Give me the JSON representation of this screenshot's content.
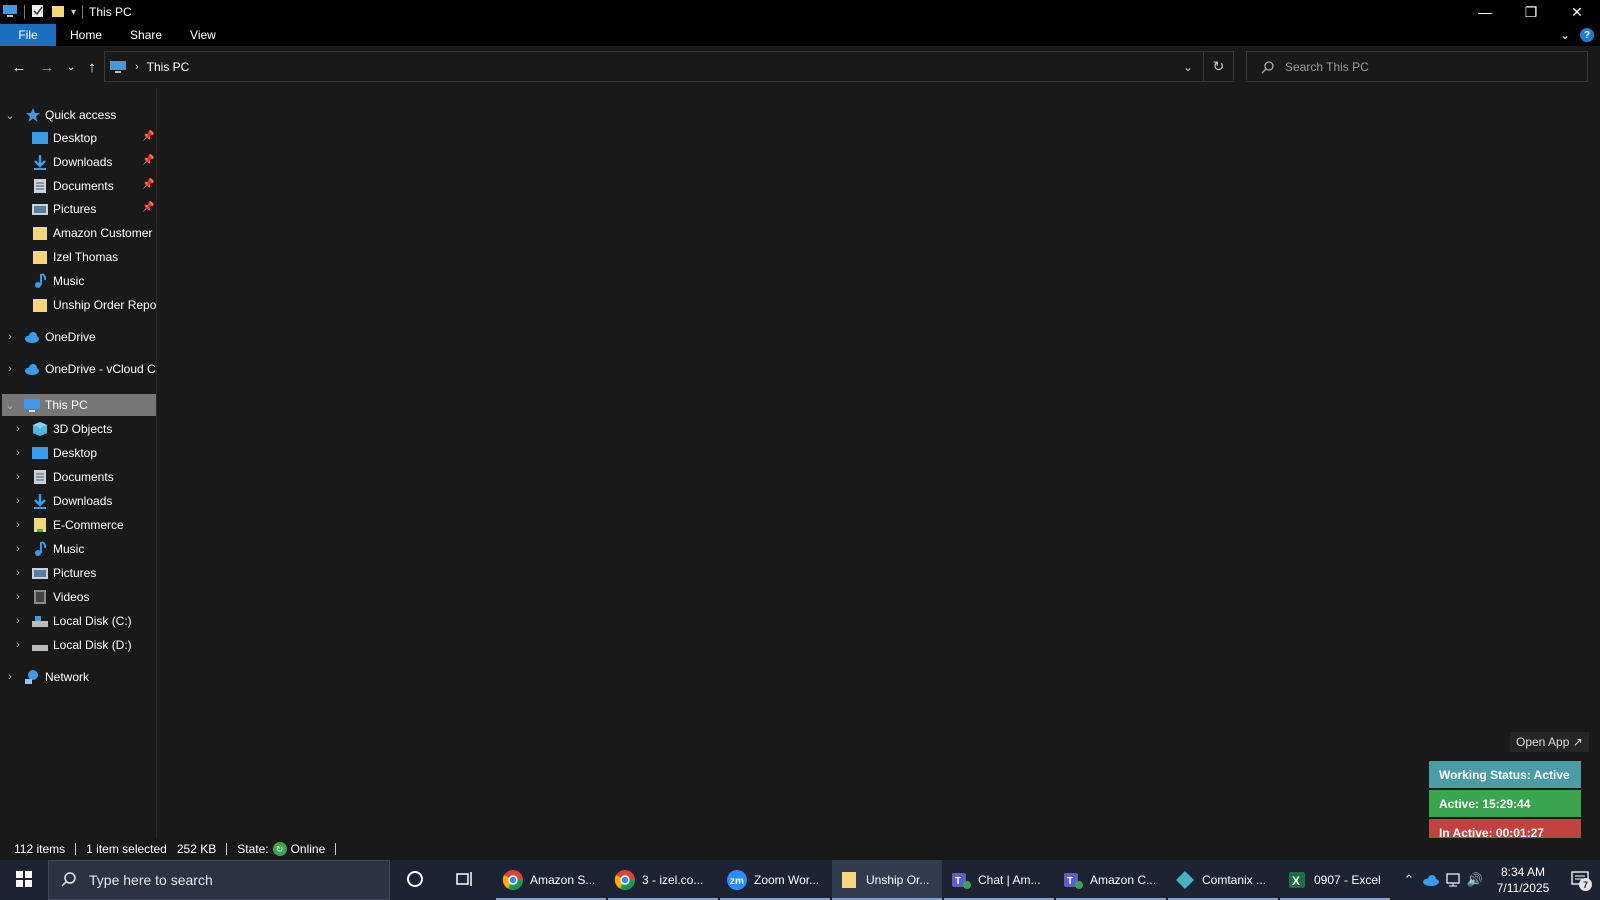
{
  "window": {
    "title": "This PC",
    "controls": [
      "minimize-icon",
      "restore-icon",
      "close-icon"
    ]
  },
  "ribbon": {
    "tabs": [
      {
        "label": "File"
      },
      {
        "label": "Home"
      },
      {
        "label": "Share"
      },
      {
        "label": "View"
      }
    ],
    "help": "?"
  },
  "address": {
    "breadcrumb": "This PC",
    "search_placeholder": "Search This PC"
  },
  "sidebar": {
    "quick_access": {
      "label": "Quick access",
      "items": [
        {
          "label": "Desktop",
          "icon": "desktop-icon",
          "pinned": true
        },
        {
          "label": "Downloads",
          "icon": "downloads-icon",
          "pinned": true
        },
        {
          "label": "Documents",
          "icon": "documents-icon",
          "pinned": true
        },
        {
          "label": "Pictures",
          "icon": "pictures-icon",
          "pinned": true
        },
        {
          "label": "Amazon Customer",
          "icon": "folder-icon",
          "pinned": false
        },
        {
          "label": "Izel Thomas",
          "icon": "folder-icon",
          "pinned": false
        },
        {
          "label": "Music",
          "icon": "music-icon",
          "pinned": false
        },
        {
          "label": "Unship Order Repor",
          "icon": "folder-icon",
          "pinned": false
        }
      ]
    },
    "onedrive": {
      "label": "OneDrive"
    },
    "onedrive_vcloud": {
      "label": "OneDrive - vCloud Cl"
    },
    "this_pc": {
      "label": "This PC",
      "items": [
        {
          "label": "3D Objects",
          "icon": "3d-objects-icon"
        },
        {
          "label": "Desktop",
          "icon": "desktop-icon"
        },
        {
          "label": "Documents",
          "icon": "documents-icon"
        },
        {
          "label": "Downloads",
          "icon": "downloads-icon"
        },
        {
          "label": "E-Commerce",
          "icon": "folder-icon"
        },
        {
          "label": "Music",
          "icon": "music-icon"
        },
        {
          "label": "Pictures",
          "icon": "pictures-icon"
        },
        {
          "label": "Videos",
          "icon": "videos-icon"
        },
        {
          "label": "Local Disk (C:)",
          "icon": "drive-icon"
        },
        {
          "label": "Local Disk (D:)",
          "icon": "drive-icon"
        }
      ]
    },
    "network": {
      "label": "Network"
    }
  },
  "statusbar": {
    "items_count": "112 items",
    "selected": "1 item selected",
    "size": "252 KB",
    "state_label": "State:",
    "state_value": "Online"
  },
  "widget": {
    "open_app": "Open App ↗",
    "working_status": "Working Status: Active",
    "active": "Active: 15:29:44",
    "inactive": "In Active: 00:01:27"
  },
  "taskbar": {
    "search_placeholder": "Type here to search",
    "apps": [
      {
        "label": "Amazon S...",
        "icon": "chrome-icon",
        "active": false
      },
      {
        "label": "3 - izel.co...",
        "icon": "chrome-icon",
        "active": false
      },
      {
        "label": "Zoom Wor...",
        "icon": "zoom-icon",
        "active": false
      },
      {
        "label": "Unship Or...",
        "icon": "folder-icon",
        "active": true
      },
      {
        "label": "Chat | Am...",
        "icon": "teams-icon",
        "active": false
      },
      {
        "label": "Amazon C...",
        "icon": "teams-icon",
        "active": false
      },
      {
        "label": "Comtanix ...",
        "icon": "comtanix-icon",
        "active": false
      },
      {
        "label": "0907 - Excel",
        "icon": "excel-icon",
        "active": false
      }
    ],
    "clock_time": "8:34 AM",
    "clock_date": "7/11/2025",
    "notification_count": "7"
  },
  "colors": {
    "background": "#191919",
    "file_tab": "#1b6fc1",
    "selected": "#777777",
    "working_status": "#4a9da6",
    "active": "#3aa54e",
    "inactive": "#c24242",
    "taskbar": "#1c2433"
  }
}
